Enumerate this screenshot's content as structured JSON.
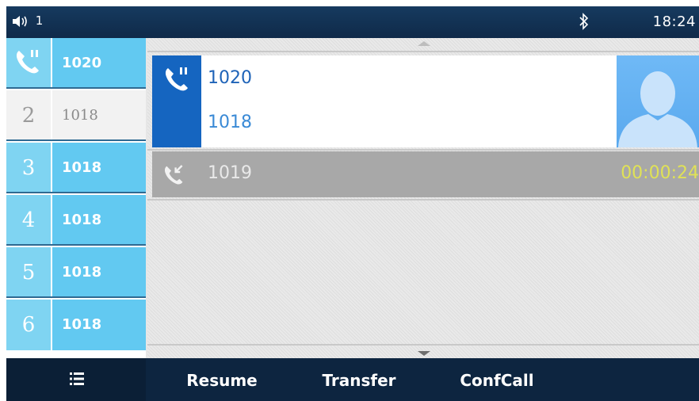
{
  "status_bar": {
    "volume_label": "1",
    "volume_icon": "speaker-volume-icon",
    "bluetooth_icon": "bluetooth-icon",
    "time": "18:24"
  },
  "lines": [
    {
      "index": "",
      "extension": "1020",
      "icon": "call-hold-icon",
      "state": "active"
    },
    {
      "index": "2",
      "extension": "1018",
      "state": "idle"
    },
    {
      "index": "3",
      "extension": "1018",
      "state": "active"
    },
    {
      "index": "4",
      "extension": "1018",
      "state": "active"
    },
    {
      "index": "5",
      "extension": "1018",
      "state": "active"
    },
    {
      "index": "6",
      "extension": "1018",
      "state": "active"
    }
  ],
  "calls": {
    "held": {
      "name": "1020",
      "number": "1018",
      "icon": "call-hold-icon",
      "avatar": "contact-avatar-icon"
    },
    "incoming": {
      "name": "1019",
      "timer": "00:00:24",
      "icon": "incoming-call-icon"
    }
  },
  "softkeys": {
    "menu_icon": "menu-list-icon",
    "resume": "Resume",
    "transfer": "Transfer",
    "confcall": "ConfCall"
  },
  "colors": {
    "header": "#163a5f",
    "line_active": "#62c9f1",
    "call_blue": "#1565c0",
    "timer": "#e0e256"
  }
}
